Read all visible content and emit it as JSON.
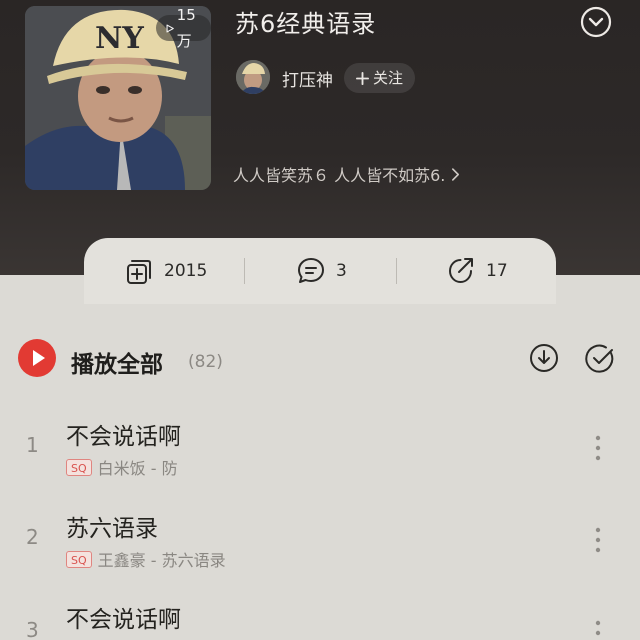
{
  "playlist": {
    "title": "苏6经典语录",
    "play_count": "15万",
    "creator_name": "打压神",
    "follow_label": "关注",
    "description": "人人皆笑苏６ 人人皆不如苏6."
  },
  "stats": {
    "collect_count": "2015",
    "comment_count": "3",
    "share_count": "17"
  },
  "list": {
    "play_all_label": "播放全部",
    "play_all_count": "(82)",
    "songs": [
      {
        "index": "1",
        "title": "不会说话啊",
        "quality": "SQ",
        "meta": "白米饭 - 防"
      },
      {
        "index": "2",
        "title": "苏六语录",
        "quality": "SQ",
        "meta": "王鑫豪 - 苏六语录"
      },
      {
        "index": "3",
        "title": "不会说话啊"
      }
    ]
  },
  "colors": {
    "accent": "#e23a33",
    "header_bg": "#2a2625",
    "list_bg": "#dcdad5"
  },
  "icons": {
    "play_count": "play-icon",
    "collapse": "chevron-down-circle-icon",
    "collect": "add-collection-icon",
    "comment": "comment-icon",
    "share": "share-icon",
    "download_all": "download-icon",
    "multi_select": "check-circle-icon",
    "more": "more-vertical-icon"
  }
}
